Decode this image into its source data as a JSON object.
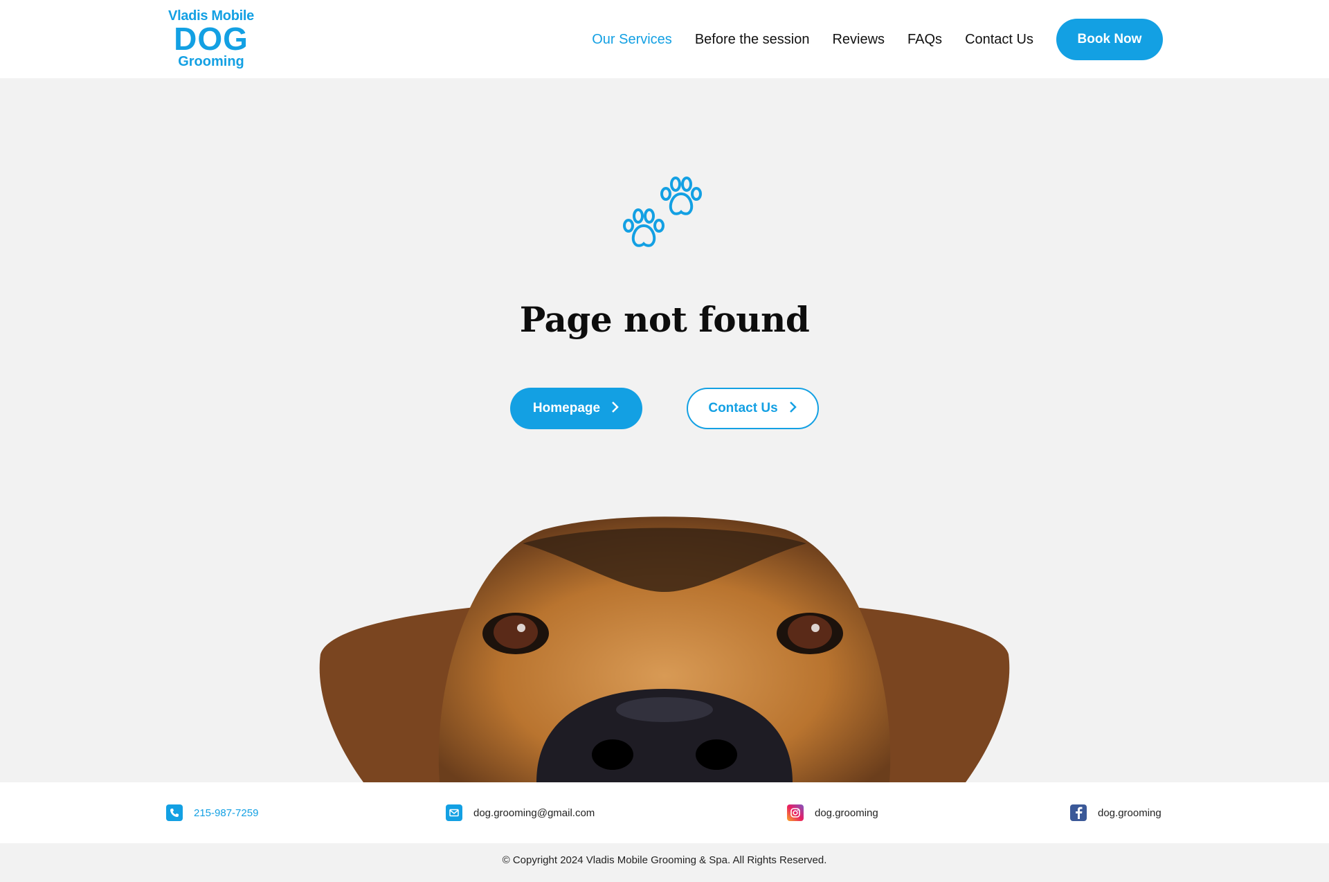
{
  "colors": {
    "accent": "#13a0e3",
    "background": "#f2f2f2",
    "text": "#111111"
  },
  "logo": {
    "line1": "Vladis Mobile",
    "line2": "DOG",
    "line3": "Grooming"
  },
  "nav": {
    "items": [
      "Our Services",
      "Before the session",
      "Reviews",
      "FAQs",
      "Contact Us"
    ],
    "active": "Our Services",
    "book_label": "Book Now"
  },
  "main": {
    "icon": "paw-prints-icon",
    "title": "Page not found",
    "homepage_label": "Homepage",
    "contact_label": "Contact Us",
    "image": "dog-peeking-image"
  },
  "footer": {
    "phone": "215-987-7259",
    "email": "dog.grooming@gmail.com",
    "instagram": "dog.grooming",
    "facebook": "dog.grooming",
    "copyright": "© Copyright 2024 Vladis Mobile Grooming & Spa. All Rights Reserved."
  }
}
